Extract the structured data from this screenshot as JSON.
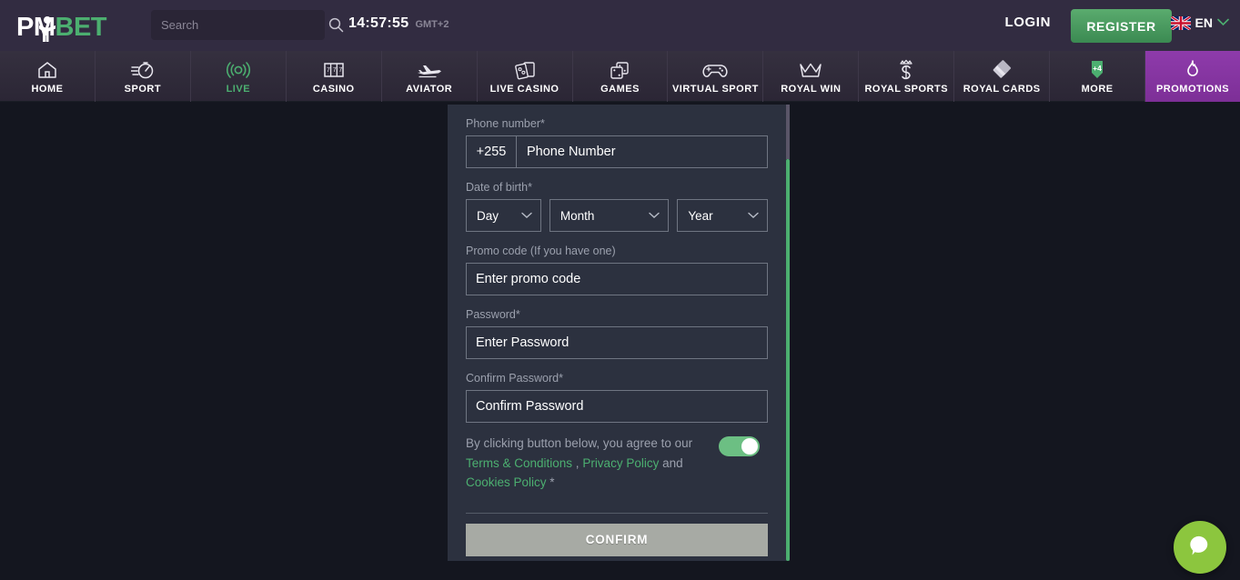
{
  "header": {
    "logo_pm": "PM",
    "logo_bet": "BET",
    "search": {
      "placeholder": "Search",
      "value": "",
      "icon": "search-icon"
    },
    "clock": {
      "time": "14:57:55",
      "timezone": "GMT+2"
    },
    "login_label": "LOGIN",
    "register_label": "REGISTER",
    "language": {
      "label": "EN",
      "flag": "uk-flag-icon",
      "chevron": "chevron-down-icon"
    },
    "accent_green": "#4caf70",
    "header_bg": "#322c41"
  },
  "nav": {
    "items": [
      {
        "label": "HOME",
        "icon": "home-icon",
        "active": false
      },
      {
        "label": "SPORT",
        "icon": "stopwatch-icon",
        "active": false
      },
      {
        "label": "LIVE",
        "icon": "live-signal-icon",
        "active": true
      },
      {
        "label": "CASINO",
        "icon": "slot-machine-icon",
        "active": false
      },
      {
        "label": "AVIATOR",
        "icon": "airplane-icon",
        "active": false
      },
      {
        "label": "LIVE CASINO",
        "icon": "playing-cards-icon",
        "active": false
      },
      {
        "label": "GAMES",
        "icon": "dice-icon",
        "active": false
      },
      {
        "label": "VIRTUAL SPORT",
        "icon": "gamepad-icon",
        "active": false
      },
      {
        "label": "ROYAL WIN",
        "icon": "crown-icon",
        "active": false
      },
      {
        "label": "ROYAL SPORTS",
        "icon": "crowned-s-icon",
        "active": false
      },
      {
        "label": "ROYAL CARDS",
        "icon": "stacked-cards-icon",
        "active": false
      },
      {
        "label": "MORE",
        "icon": "plus-four-badge-icon",
        "badge": "+4",
        "active": false
      },
      {
        "label": "PROMOTIONS",
        "icon": "flame-icon",
        "active": false,
        "highlight": true
      }
    ],
    "promotions_bg": "#8e3bab"
  },
  "modal": {
    "phone": {
      "label": "Phone number*",
      "prefix": "+255",
      "placeholder": "Phone Number",
      "value": ""
    },
    "dob": {
      "label": "Date of birth*",
      "day": "Day",
      "month": "Month",
      "year": "Year",
      "chevron": "chevron-down-icon"
    },
    "promo": {
      "label": "Promo code (If you have one)",
      "placeholder": "Enter promo code",
      "value": ""
    },
    "password": {
      "label": "Password*",
      "placeholder": "Enter Password",
      "value": ""
    },
    "confirm_password": {
      "label": "Confirm Password*",
      "placeholder": "Confirm Password",
      "value": ""
    },
    "agreement": {
      "intro": "By clicking button below, you agree to our",
      "terms": "Terms & Conditions",
      "comma": " , ",
      "privacy": "Privacy Policy",
      "and": " and ",
      "cookies": "Cookies Policy",
      "required": " *",
      "toggle_on": true
    },
    "confirm_button": {
      "label": "CONFIRM",
      "disabled": true,
      "color": "#a7aaa4"
    },
    "scrollbar_color": "#4caf70"
  },
  "chat": {
    "icon": "chat-bubble-icon",
    "color": "#8cc63e"
  }
}
